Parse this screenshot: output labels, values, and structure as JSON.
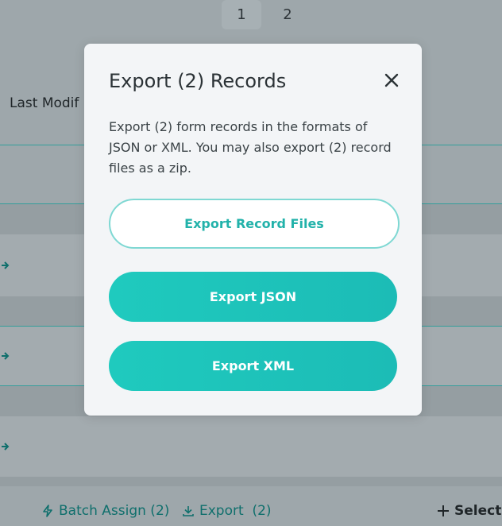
{
  "pagination": {
    "pages": [
      "1",
      "2"
    ],
    "active": "1"
  },
  "table": {
    "header_label": "Last Modif"
  },
  "toolbar": {
    "batch_assign_label": "Batch Assign (2)",
    "export_label": "Export  (2)",
    "select_all_label": "Select A"
  },
  "modal": {
    "title": "Export (2) Records",
    "description": "Export (2) form records in the formats of JSON or XML. You may also export (2) record files as a zip.",
    "export_files_label": "Export Record Files",
    "export_json_label": "Export JSON",
    "export_xml_label": "Export XML"
  },
  "colors": {
    "accent": "#1fc4bb",
    "overlay": "#9ea7ab",
    "modal_bg": "#f3f5f7",
    "link": "#0f6f6c"
  },
  "icons": [
    "close-icon",
    "lightning-icon",
    "download-icon",
    "plus-icon",
    "arrow-right-icon"
  ]
}
